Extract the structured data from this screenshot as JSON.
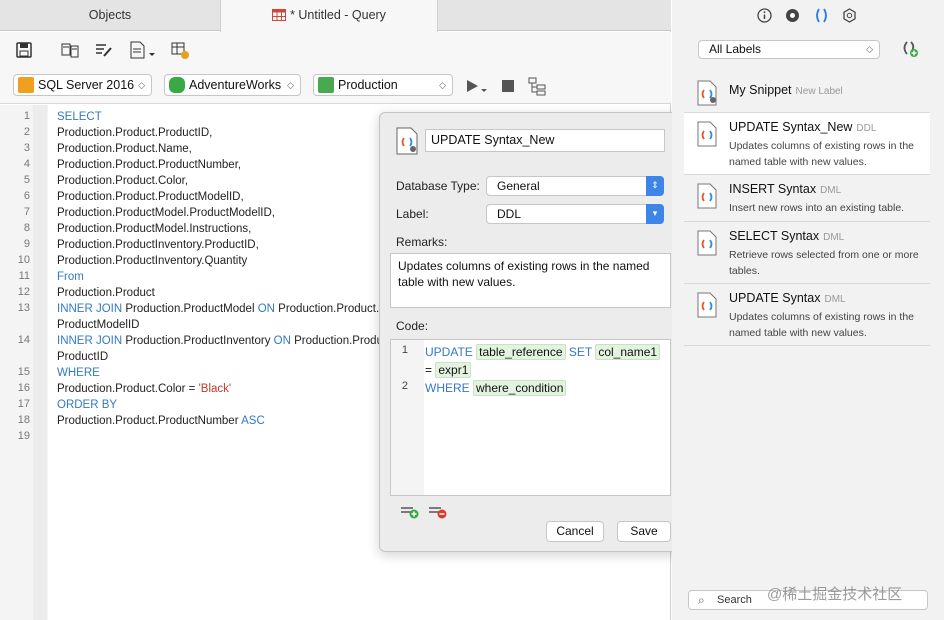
{
  "tabs": {
    "objects": "Objects",
    "query": "* Untitled - Query"
  },
  "connection": {
    "server": "SQL Server 2016",
    "database": "AdventureWorks",
    "schema": "Production"
  },
  "editor": {
    "line_numbers": [
      "1",
      "2",
      "3",
      "4",
      "5",
      "6",
      "7",
      "8",
      "9",
      "10",
      "11",
      "12",
      "13",
      "",
      "14",
      "",
      "15",
      "16",
      "17",
      "18",
      "19"
    ],
    "lines": [
      [
        [
          "kw",
          "SELECT"
        ]
      ],
      [
        [
          "",
          "Production.Product.ProductID,"
        ]
      ],
      [
        [
          "",
          "Production.Product.Name,"
        ]
      ],
      [
        [
          "",
          "Production.Product.ProductNumber,"
        ]
      ],
      [
        [
          "",
          "Production.Product.Color,"
        ]
      ],
      [
        [
          "",
          "Production.Product.ProductModelID,"
        ]
      ],
      [
        [
          "",
          "Production.ProductModel.ProductModelID,"
        ]
      ],
      [
        [
          "",
          "Production.ProductModel.Instructions,"
        ]
      ],
      [
        [
          "",
          "Production.ProductInventory.ProductID,"
        ]
      ],
      [
        [
          "",
          "Production.ProductInventory.Quantity"
        ]
      ],
      [
        [
          "kw",
          "From"
        ]
      ],
      [
        [
          "",
          "Production.Product"
        ]
      ],
      [
        [
          "kw",
          "INNER JOIN"
        ],
        [
          "",
          " Production.ProductModel "
        ],
        [
          "kw",
          "ON"
        ],
        [
          "",
          " Production.Product.P"
        ]
      ],
      [
        [
          "",
          "ProductModelID"
        ]
      ],
      [
        [
          "kw",
          "INNER JOIN"
        ],
        [
          "",
          " Production.ProductInventory "
        ],
        [
          "kw",
          "ON"
        ],
        [
          "",
          " Production.Produ"
        ]
      ],
      [
        [
          "",
          "ProductID"
        ]
      ],
      [
        [
          "kw",
          "WHERE"
        ]
      ],
      [
        [
          "",
          "Production.Product.Color = "
        ],
        [
          "str",
          "'Black'"
        ]
      ],
      [
        [
          "kw",
          "ORDER BY"
        ]
      ],
      [
        [
          "",
          "Production.Product.ProductNumber "
        ],
        [
          "kw",
          "ASC"
        ]
      ],
      [
        [
          "",
          ""
        ]
      ]
    ]
  },
  "popover": {
    "name": "UPDATE Syntax_New",
    "database_type_label": "Database Type:",
    "database_type": "General",
    "label_label": "Label:",
    "label": "DDL",
    "remarks_label": "Remarks:",
    "remarks": "Updates columns of existing rows in the named table with new values.",
    "code_label": "Code:",
    "code": {
      "l1_num": "1",
      "l2_num": "2",
      "update": "UPDATE",
      "table_reference": "table_reference",
      "set": "SET",
      "col_name1": "col_name1",
      "eq": "=",
      "expr1": "expr1",
      "where": "WHERE",
      "where_condition": "where_condition"
    },
    "cancel": "Cancel",
    "save": "Save"
  },
  "right_panel": {
    "labels_filter": "All Labels",
    "snippets": [
      {
        "title": "My Snippet",
        "tag": "New Label",
        "desc": ""
      },
      {
        "title": "UPDATE Syntax_New",
        "tag": "DDL",
        "desc": "Updates columns of existing rows in the named table with new values."
      },
      {
        "title": "INSERT Syntax",
        "tag": "DML",
        "desc": "Insert new rows into an existing table."
      },
      {
        "title": "SELECT Syntax",
        "tag": "DML",
        "desc": "Retrieve rows selected from one or more tables."
      },
      {
        "title": "UPDATE Syntax",
        "tag": "DML",
        "desc": "Updates columns of existing rows in the named table with new values."
      }
    ],
    "search_placeholder": "Search",
    "watermark": "@稀土掘金技术社区"
  },
  "colors": {
    "keyword": "#3478c8",
    "string": "#c0392b",
    "accent": "#3d85e6",
    "placeholder_bg": "#e3f3e0"
  }
}
